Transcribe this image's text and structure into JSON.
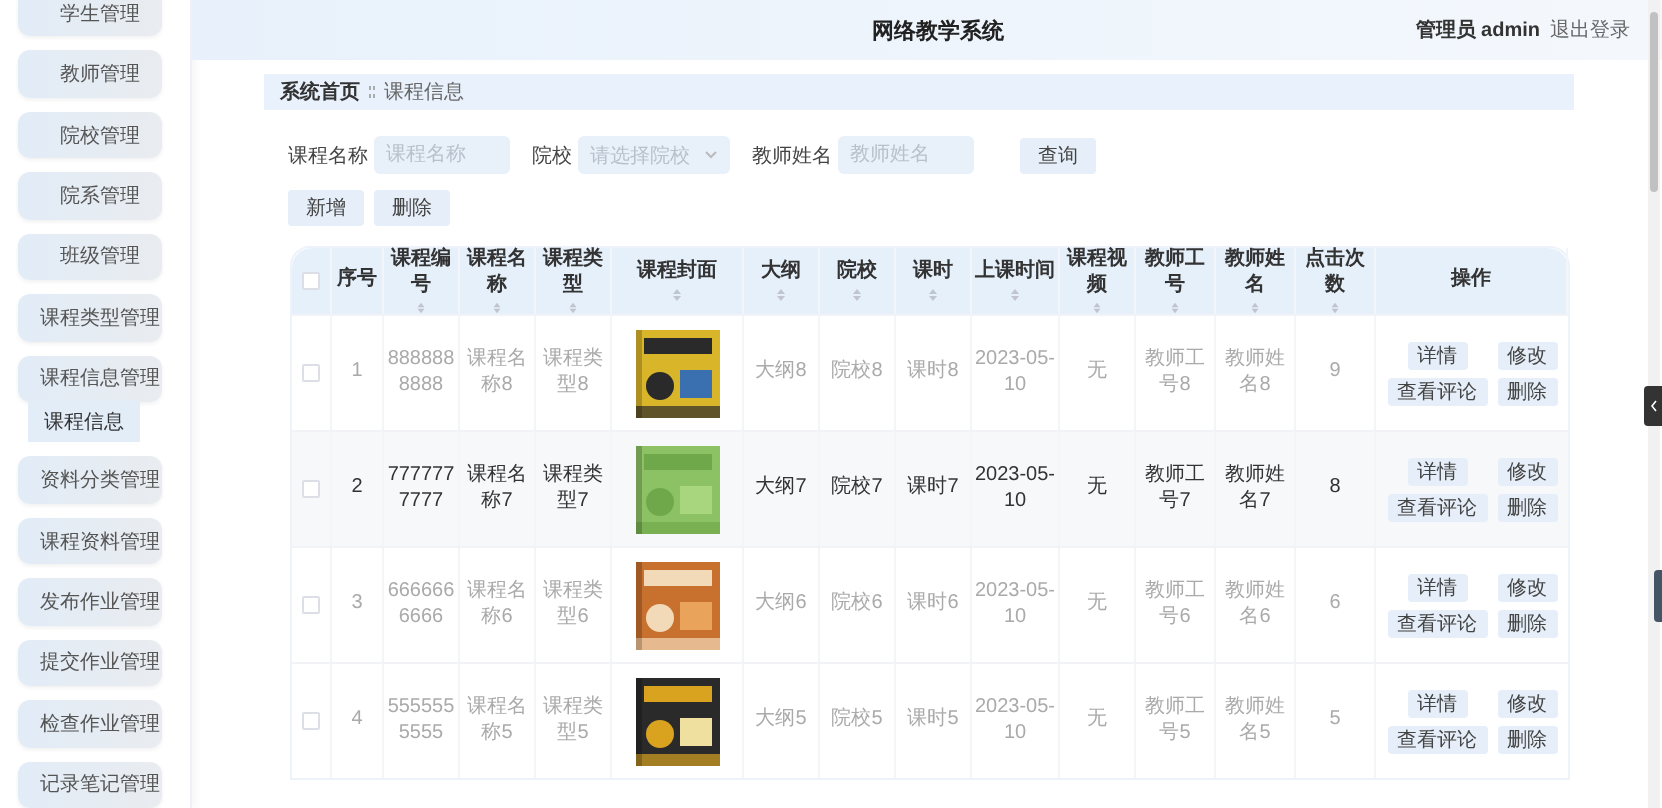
{
  "header": {
    "title": "网络教学系统",
    "user": "管理员 admin",
    "logout": "退出登录"
  },
  "sidebar": {
    "items": [
      {
        "label": "学生管理",
        "selected": false
      },
      {
        "label": "教师管理",
        "selected": false
      },
      {
        "label": "院校管理",
        "selected": false
      },
      {
        "label": "院系管理",
        "selected": false
      },
      {
        "label": "班级管理",
        "selected": false
      },
      {
        "label": "课程类型管理",
        "selected": false
      },
      {
        "label": "课程信息管理",
        "selected": false,
        "children": [
          {
            "label": "课程信息",
            "selected": true
          }
        ]
      },
      {
        "label": "资料分类管理",
        "selected": false
      },
      {
        "label": "课程资料管理",
        "selected": false
      },
      {
        "label": "发布作业管理",
        "selected": false
      },
      {
        "label": "提交作业管理",
        "selected": false
      },
      {
        "label": "检查作业管理",
        "selected": false
      },
      {
        "label": "记录笔记管理",
        "selected": false
      }
    ]
  },
  "breadcrumb": [
    "系统首页",
    "课程信息"
  ],
  "search": {
    "fields": [
      {
        "kind": "input",
        "label": "课程名称",
        "placeholder": "课程名称"
      },
      {
        "kind": "select",
        "label": "院校",
        "placeholder": "请选择院校"
      },
      {
        "kind": "input",
        "label": "教师姓名",
        "placeholder": "教师姓名"
      }
    ],
    "button": "查询"
  },
  "actions": [
    "新增",
    "删除"
  ],
  "table": {
    "select_all": {
      "checked": false
    },
    "columns": [
      {
        "label": "序号",
        "sortable": false
      },
      {
        "label": "课程编号",
        "sortable": true
      },
      {
        "label": "课程名称",
        "sortable": true
      },
      {
        "label": "课程类型",
        "sortable": true
      },
      {
        "label": "课程封面",
        "sortable": true
      },
      {
        "label": "大纲",
        "sortable": true
      },
      {
        "label": "院校",
        "sortable": true
      },
      {
        "label": "课时",
        "sortable": true
      },
      {
        "label": "上课时间",
        "sortable": true
      },
      {
        "label": "课程视频",
        "sortable": true
      },
      {
        "label": "教师工号",
        "sortable": true
      },
      {
        "label": "教师姓名",
        "sortable": true
      },
      {
        "label": "点击次数",
        "sortable": true
      },
      {
        "label": "操作",
        "sortable": false
      }
    ],
    "rows": [
      {
        "checked": false,
        "highlighted": false,
        "cells": [
          "1",
          "8888888888",
          "课程名称8",
          "课程类型8",
          {
            "kind": "picture"
          },
          "大纲8",
          "院校8",
          "课时8",
          "2023-05-10",
          "无",
          "教师工号8",
          "教师姓名8",
          "9",
          [
            "详情",
            "修改",
            "查看评论",
            "删除"
          ]
        ]
      },
      {
        "checked": false,
        "highlighted": true,
        "cells": [
          "2",
          "7777777777",
          "课程名称7",
          "课程类型7",
          {
            "kind": "picture"
          },
          "大纲7",
          "院校7",
          "课时7",
          "2023-05-10",
          "无",
          "教师工号7",
          "教师姓名7",
          "8",
          [
            "详情",
            "修改",
            "查看评论",
            "删除"
          ]
        ]
      },
      {
        "checked": false,
        "highlighted": false,
        "cells": [
          "3",
          "6666666666",
          "课程名称6",
          "课程类型6",
          {
            "kind": "picture"
          },
          "大纲6",
          "院校6",
          "课时6",
          "2023-05-10",
          "无",
          "教师工号6",
          "教师姓名6",
          "6",
          [
            "详情",
            "修改",
            "查看评论",
            "删除"
          ]
        ]
      },
      {
        "checked": false,
        "highlighted": false,
        "cells": [
          "4",
          "5555555555",
          "课程名称5",
          "课程类型5",
          {
            "kind": "picture"
          },
          "大纲5",
          "院校5",
          "课时5",
          "2023-05-10",
          "无",
          "教师工号5",
          "教师姓名5",
          "5",
          [
            "详情",
            "修改",
            "查看评论",
            "删除"
          ]
        ]
      }
    ]
  }
}
